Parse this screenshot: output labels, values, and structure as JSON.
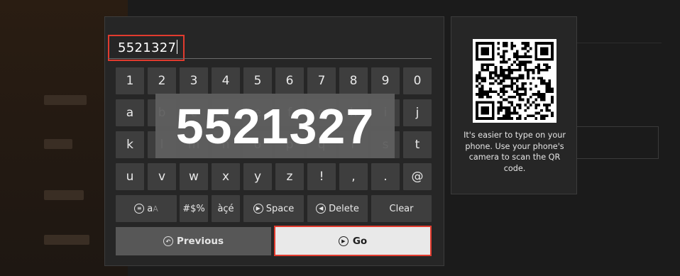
{
  "input": {
    "value": "5521327"
  },
  "overlay": {
    "code": "5521327"
  },
  "keys": {
    "row1": [
      "1",
      "2",
      "3",
      "4",
      "5",
      "6",
      "7",
      "8",
      "9",
      "0"
    ],
    "row2": [
      "a",
      "b",
      "c",
      "d",
      "e",
      "f",
      "g",
      "h",
      "i",
      "j"
    ],
    "row3": [
      "k",
      "l",
      "m",
      "n",
      "o",
      "p",
      "q",
      "r",
      "s",
      "t"
    ],
    "row4": [
      "u",
      "v",
      "w",
      "x",
      "y",
      "z",
      "!",
      ",",
      ".",
      "@"
    ]
  },
  "special_keys": {
    "case_label": "a",
    "case_label_alt": "A",
    "symbols_label": "#$%",
    "accents_label": "àçé",
    "space_label": "Space",
    "delete_label": "Delete",
    "clear_label": "Clear"
  },
  "actions": {
    "previous_label": "Previous",
    "go_label": "Go"
  },
  "qr_panel": {
    "text": "It's easier to type on your phone. Use your phone's camera to scan the QR code."
  },
  "colors": {
    "focus_border": "#e23b2e",
    "key_bg": "#3e3e3e",
    "dialog_bg": "#262626"
  }
}
